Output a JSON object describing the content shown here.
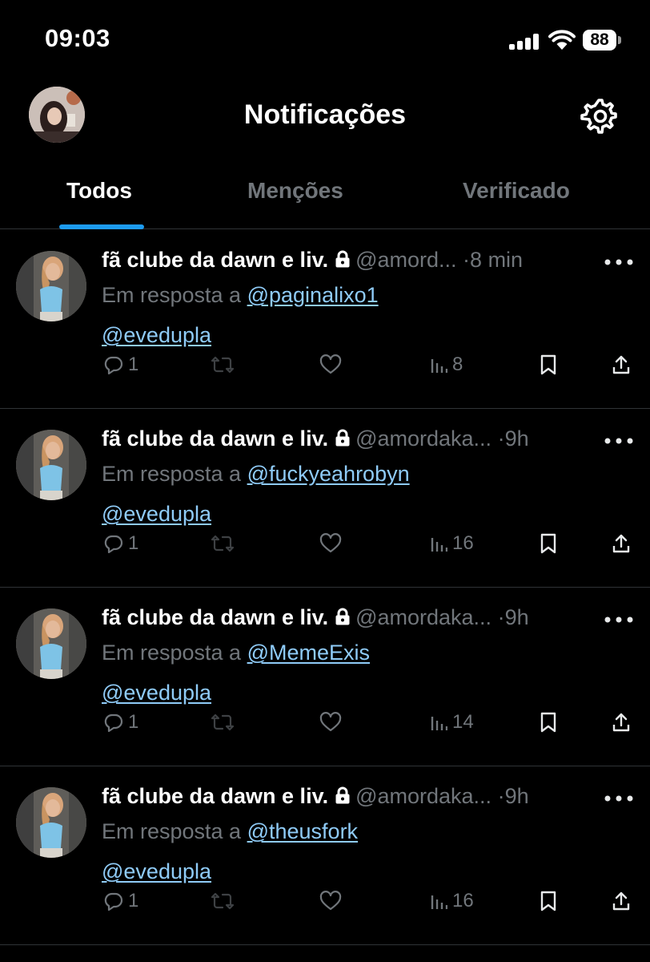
{
  "status_bar": {
    "time": "09:03",
    "battery": "88"
  },
  "header": {
    "title": "Notificações"
  },
  "tabs": [
    {
      "label": "Todos",
      "active": true
    },
    {
      "label": "Menções",
      "active": false
    },
    {
      "label": "Verificado",
      "active": false
    }
  ],
  "reply_prefix": "Em resposta a",
  "accent_color": "#1d9bf0",
  "notifications": [
    {
      "name": "fã clube da dawn e liv.",
      "handle": "@amord...",
      "separator": "·",
      "time": "8 min",
      "reply_to": "@paginalixo1",
      "body": "@evedupla",
      "replies": "1",
      "views": "8"
    },
    {
      "name": "fã clube da dawn e liv.",
      "handle": "@amordaka...",
      "separator": "·",
      "time": "9h",
      "reply_to": "@fuckyeahrobyn",
      "body": "@evedupla",
      "replies": "1",
      "views": "16"
    },
    {
      "name": "fã clube da dawn e liv.",
      "handle": "@amordaka...",
      "separator": "·",
      "time": "9h",
      "reply_to": "@MemeExis",
      "body": "@evedupla",
      "replies": "1",
      "views": "14"
    },
    {
      "name": "fã clube da dawn e liv.",
      "handle": "@amordaka...",
      "separator": "·",
      "time": "9h",
      "reply_to": "@theusfork",
      "body": "@evedupla",
      "replies": "1",
      "views": "16"
    }
  ]
}
